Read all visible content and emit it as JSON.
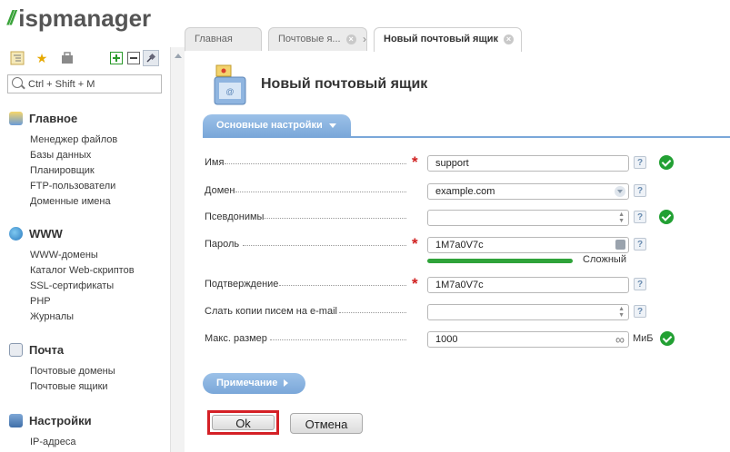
{
  "app": {
    "logo_text": "ispmanager"
  },
  "sidebar": {
    "search_placeholder": "Ctrl + Shift + M",
    "groups": [
      {
        "title": "Главное",
        "icon": "home-icon",
        "items": [
          "Менеджер файлов",
          "Базы данных",
          "Планировщик",
          "FTP-пользователи",
          "Доменные имена"
        ]
      },
      {
        "title": "WWW",
        "icon": "globe-icon",
        "items": [
          "WWW-домены",
          "Каталог Web-скриптов",
          "SSL-сертификаты",
          "PHP",
          "Журналы"
        ]
      },
      {
        "title": "Почта",
        "icon": "mail-icon",
        "items": [
          "Почтовые домены",
          "Почтовые ящики"
        ]
      },
      {
        "title": "Настройки",
        "icon": "settings-icon",
        "items": [
          "IP-адреса"
        ]
      }
    ]
  },
  "tabs": [
    {
      "label": "Главная"
    },
    {
      "label": "Почтовые я..."
    },
    {
      "label": "Новый почтовый ящик"
    }
  ],
  "page": {
    "title": "Новый почтовый ящик",
    "section_tab": "Основные настройки",
    "fields": {
      "name": {
        "label": "Имя",
        "value": "support"
      },
      "domain": {
        "label": "Домен",
        "value": "example.com"
      },
      "aliases": {
        "label": "Псевдонимы",
        "value": ""
      },
      "password": {
        "label": "Пароль",
        "value": "1M7a0V7c",
        "strength": "Сложный"
      },
      "confirm": {
        "label": "Подтверждение",
        "value": "1M7a0V7c"
      },
      "copy": {
        "label": "Слать копии писем на e-mail",
        "value": ""
      },
      "maxsize": {
        "label": "Макс. размер",
        "value": "1000",
        "unit": "МиБ"
      }
    },
    "help_mark": "?",
    "note_button": "Примечание",
    "ok_button": "Ok",
    "cancel_button": "Отмена"
  },
  "colors": {
    "accent": "#7aa7d9",
    "required": "#d02020",
    "valid": "#22a033",
    "ok_highlight": "#d42026"
  }
}
